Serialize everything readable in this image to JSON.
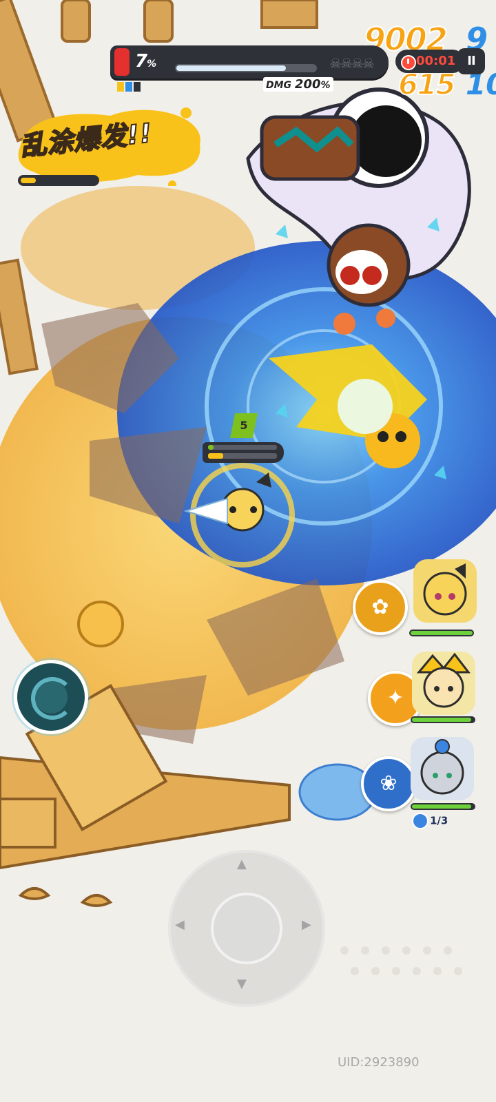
{
  "hud": {
    "boss_percent": "7",
    "percent_sign": "%",
    "dmg_label": "DMG",
    "dmg_value": "200",
    "dmg_unit": "%",
    "boss_hp_fraction": 0.78,
    "skull_count": 4,
    "timer": "00:01",
    "pause_label": "II"
  },
  "score": {
    "line1": "9002",
    "line1_blue": "9",
    "line2": "615",
    "line2_blue": "10"
  },
  "banner": {
    "text": "乱涂爆发!!",
    "gauge_fraction": 0.2
  },
  "player": {
    "level": "5",
    "shield_fraction": 0.08,
    "energy_fraction": 0.22
  },
  "team": {
    "members": [
      {
        "name": "member-1",
        "hp_fraction": 1.0,
        "skill_color": "#e9a11c",
        "skill_icon": "fan-icon"
      },
      {
        "name": "member-2",
        "hp_fraction": 0.96,
        "skill_color": "#f3a11c",
        "skill_icon": "spark-icon"
      },
      {
        "name": "member-3",
        "hp_fraction": 0.96,
        "skill_color": "#2f6fc9",
        "skill_icon": "flower-icon"
      }
    ],
    "charges": "1/3"
  },
  "uid": "UID:2923890",
  "colors": {
    "accent_orange": "#f7a313",
    "accent_blue": "#2f8fe6",
    "hud_dark": "#2f3138",
    "hp_green": "#6cd13a",
    "alert_red": "#e4312f"
  }
}
